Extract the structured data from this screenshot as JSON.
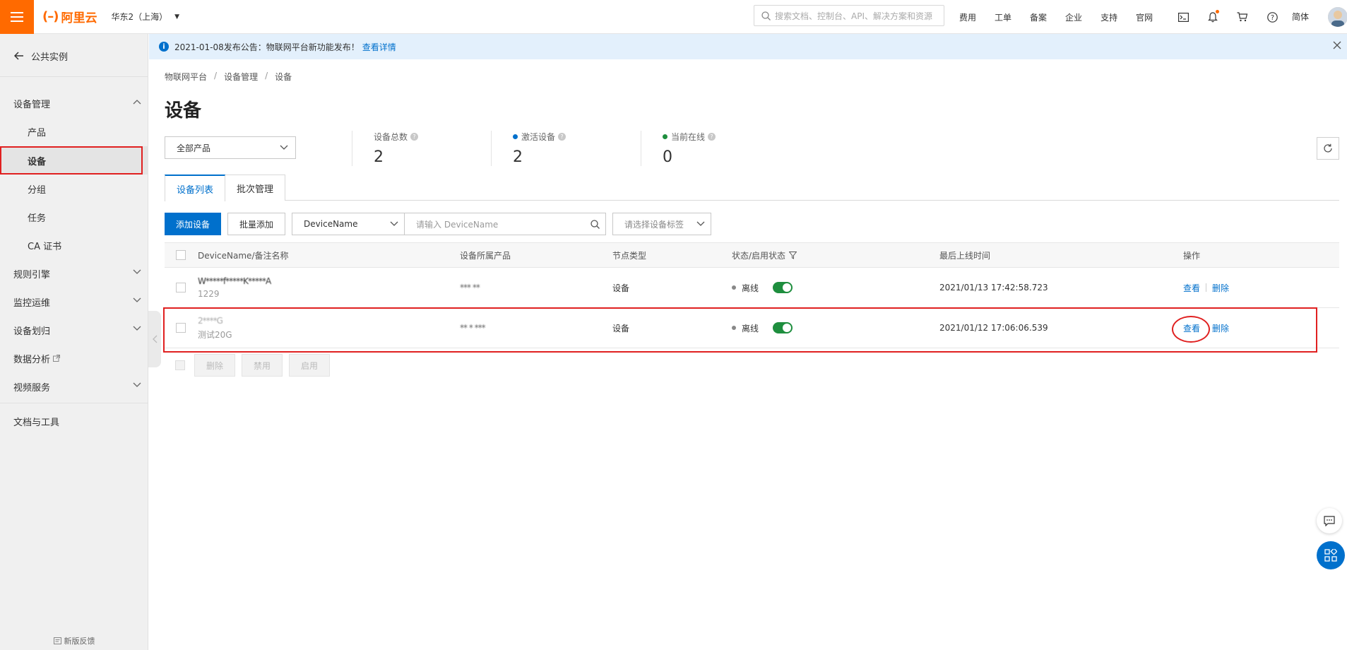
{
  "header": {
    "logo_text": "阿里云",
    "region": "华东2（上海）",
    "search_placeholder": "搜索文档、控制台、API、解决方案和资源",
    "links": [
      "费用",
      "工单",
      "备案",
      "企业",
      "支持",
      "官网"
    ],
    "lang": "简体"
  },
  "sidebar": {
    "back_label": "公共实例",
    "groups": [
      {
        "label": "设备管理"
      },
      {
        "label": "产品"
      },
      {
        "label": "设备"
      },
      {
        "label": "分组"
      },
      {
        "label": "任务"
      },
      {
        "label": "CA 证书"
      },
      {
        "label": "规则引擎"
      },
      {
        "label": "监控运维"
      },
      {
        "label": "设备划归"
      },
      {
        "label": "数据分析"
      },
      {
        "label": "视频服务"
      },
      {
        "label": "文档与工具"
      }
    ],
    "footer": "新版反馈"
  },
  "banner": {
    "text": "2021-01-08发布公告：物联网平台新功能发布！",
    "link": "查看详情"
  },
  "breadcrumb": [
    "物联网平台",
    "设备管理",
    "设备"
  ],
  "page_title": "设备",
  "product_select": "全部产品",
  "stats": [
    {
      "label": "设备总数",
      "value": "2",
      "dot": ""
    },
    {
      "label": "激活设备",
      "value": "2",
      "dot": "#0070cc"
    },
    {
      "label": "当前在线",
      "value": "0",
      "dot": "#1e8e3e"
    }
  ],
  "tabs": [
    "设备列表",
    "批次管理"
  ],
  "toolbar": {
    "add": "添加设备",
    "batch_add": "批量添加",
    "filter_field": "DeviceName",
    "filter_placeholder": "请输入 DeviceName",
    "tag_placeholder": "请选择设备标签"
  },
  "table": {
    "headers": [
      "DeviceName/备注名称",
      "设备所属产品",
      "节点类型",
      "状态/启用状态",
      "最后上线时间",
      "操作"
    ],
    "rows": [
      {
        "name": "W*****f*****K*****A",
        "note": "1229",
        "product": "*** **",
        "node": "设备",
        "status": "离线",
        "last_online": "2021/01/13 17:42:58.723",
        "view": "查看",
        "delete": "删除"
      },
      {
        "name": "2****G",
        "note": "测试20G",
        "product": "** * ***",
        "node": "设备",
        "status": "离线",
        "last_online": "2021/01/12 17:06:06.539",
        "view": "查看",
        "delete": "删除"
      }
    ]
  },
  "bulk": [
    "删除",
    "禁用",
    "启用"
  ],
  "colors": {
    "accent": "#ff6a00",
    "primary": "#0070cc",
    "highlight": "#e02020",
    "online": "#1e8e3e"
  }
}
